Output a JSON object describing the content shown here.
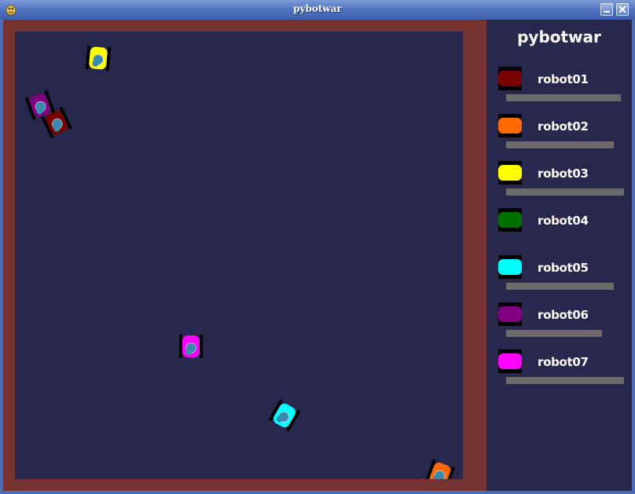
{
  "window": {
    "title": "pybotwar"
  },
  "panel": {
    "title": "pybotwar"
  },
  "colors": {
    "wall": "#753332",
    "arena": "#28284f",
    "panel": "#28284f",
    "healthbar": "#6b6b6b",
    "turret": "#3a8ab0"
  },
  "robots": [
    {
      "name": "robot01",
      "color": "#7a0000",
      "health": 0.97
    },
    {
      "name": "robot02",
      "color": "#ff6a00",
      "health": 0.91
    },
    {
      "name": "robot03",
      "color": "#ffff00",
      "health": 1.0
    },
    {
      "name": "robot04",
      "color": "#007000",
      "health": 0.0
    },
    {
      "name": "robot05",
      "color": "#00ffff",
      "health": 0.91
    },
    {
      "name": "robot06",
      "color": "#800080",
      "health": 0.81
    },
    {
      "name": "robot07",
      "color": "#ff00ff",
      "health": 1.0
    }
  ]
}
